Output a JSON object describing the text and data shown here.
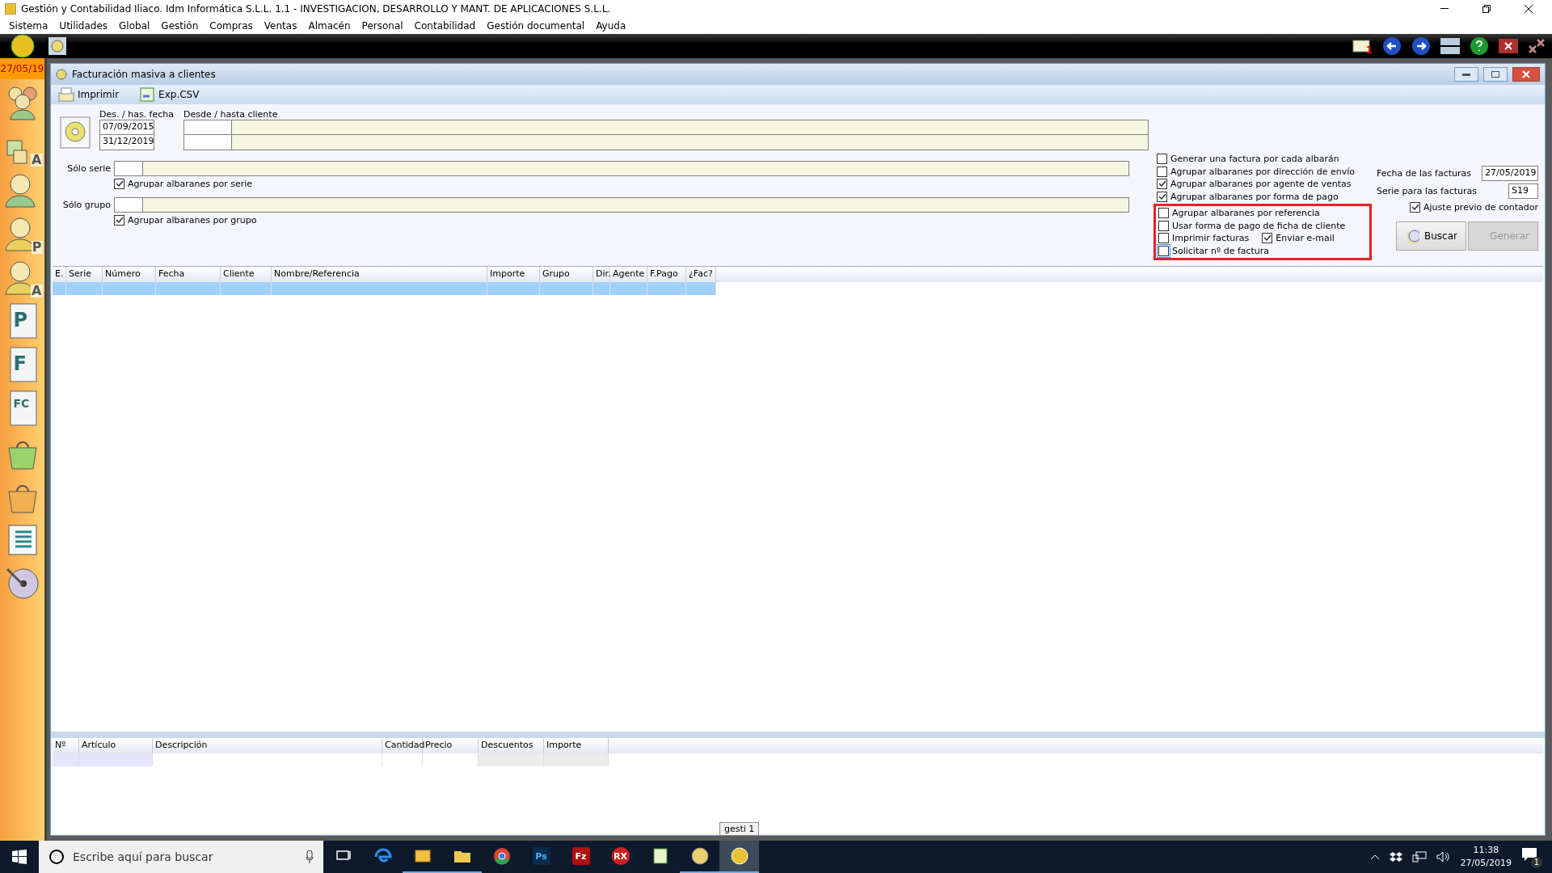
{
  "window": {
    "title": "Gestión y Contabilidad Iliaco. Idm Informática S.L.L. 1.1 - INVESTIGACION, DESARROLLO Y MANT. DE APLICACIONES S.L.L."
  },
  "menu": [
    "Sistema",
    "Utilidades",
    "Global",
    "Gestión",
    "Compras",
    "Ventas",
    "Almacén",
    "Personal",
    "Contabilidad",
    "Gestión documental",
    "Ayuda"
  ],
  "mail_badge": "1",
  "date_badge": "27/05/19",
  "sidebar": [
    {
      "kind": "people"
    },
    {
      "kind": "cubes",
      "glyph": "A"
    },
    {
      "kind": "person"
    },
    {
      "kind": "person",
      "glyph": "P"
    },
    {
      "kind": "person",
      "glyph": "A"
    },
    {
      "kind": "doc",
      "glyph": "P"
    },
    {
      "kind": "doc",
      "glyph": "F"
    },
    {
      "kind": "doc",
      "glyph": "FC"
    },
    {
      "kind": "bag"
    },
    {
      "kind": "bag2"
    },
    {
      "kind": "list"
    },
    {
      "kind": "disc"
    }
  ],
  "child": {
    "title": "Facturación masiva a clientes",
    "toolbar": [
      "Imprimir",
      "Exp.CSV"
    ],
    "date_label": "Des. / has. fecha",
    "date_from": "07/09/2015",
    "date_to": "31/12/2019",
    "client_label": "Desde / hasta cliente",
    "serie_label": "Sólo serie",
    "serie_group": {
      "label": "Agrupar albaranes por serie",
      "checked": true
    },
    "grupo_label": "Sólo grupo",
    "grupo_group": {
      "label": "Agrupar albaranes por grupo",
      "checked": true
    },
    "options": [
      {
        "label": "Generar una factura por cada albarán",
        "checked": false,
        "focused": false
      },
      {
        "label": "Agrupar albaranes por dirección de envío",
        "checked": false,
        "focused": false
      },
      {
        "label": "Agrupar albaranes por agente de ventas",
        "checked": true,
        "focused": false
      },
      {
        "label": "Agrupar albaranes por forma de pago",
        "checked": true,
        "focused": false
      },
      {
        "label": "Agrupar albaranes por referencia",
        "checked": false,
        "focused": false
      },
      {
        "label": "Usar forma de pago de ficha de cliente",
        "checked": false,
        "focused": false
      },
      {
        "label": "Imprimir facturas",
        "checked": false,
        "focused": false,
        "extra": {
          "label": "Enviar e-mail",
          "checked": true
        }
      },
      {
        "label": "Solicitar nº de factura",
        "checked": false,
        "focused": true
      }
    ],
    "invoice_date_label": "Fecha de las facturas",
    "invoice_date": "27/05/2019",
    "invoice_serie_label": "Serie para las facturas",
    "invoice_serie": "S19",
    "adjust": {
      "label": "Ajuste previo de contador",
      "checked": true
    },
    "buttons": [
      {
        "label": "Buscar",
        "disabled": false
      },
      {
        "label": "Generar",
        "disabled": true
      }
    ],
    "grid": {
      "columns": [
        "E.",
        "Serie",
        "Número",
        "Fecha",
        "Cliente",
        "Nombre/Referencia",
        "Importe",
        "Grupo",
        "Dir.",
        "Agente",
        "F.Pago",
        "¿Fac?"
      ],
      "rows": [
        {
          "selected": true
        }
      ]
    },
    "lines": {
      "columns": [
        "Nº",
        "Artículo",
        "Descripción",
        "Cantidad",
        "Precio",
        "Descuentos",
        "Importe"
      ]
    }
  },
  "taskbar": {
    "search_placeholder": "Escribe aquí para buscar",
    "apps": [
      {
        "kind": "taskview",
        "active": false
      },
      {
        "kind": "edge",
        "active": false
      },
      {
        "kind": "mail",
        "active": true
      },
      {
        "kind": "folder",
        "active": true
      },
      {
        "kind": "chrome",
        "active": false
      },
      {
        "kind": "ps",
        "glyph": "Ps",
        "active": false
      },
      {
        "kind": "fz",
        "glyph": "Fz",
        "active": false
      },
      {
        "kind": "rx",
        "glyph": "RX",
        "active": false
      },
      {
        "kind": "sheet",
        "active": false
      },
      {
        "kind": "app",
        "active": true
      },
      {
        "kind": "app2",
        "active": true,
        "selected": true
      }
    ],
    "tooltip": "gesti 1",
    "time": "11:38",
    "date": "27/05/2019",
    "notifications": "1"
  }
}
